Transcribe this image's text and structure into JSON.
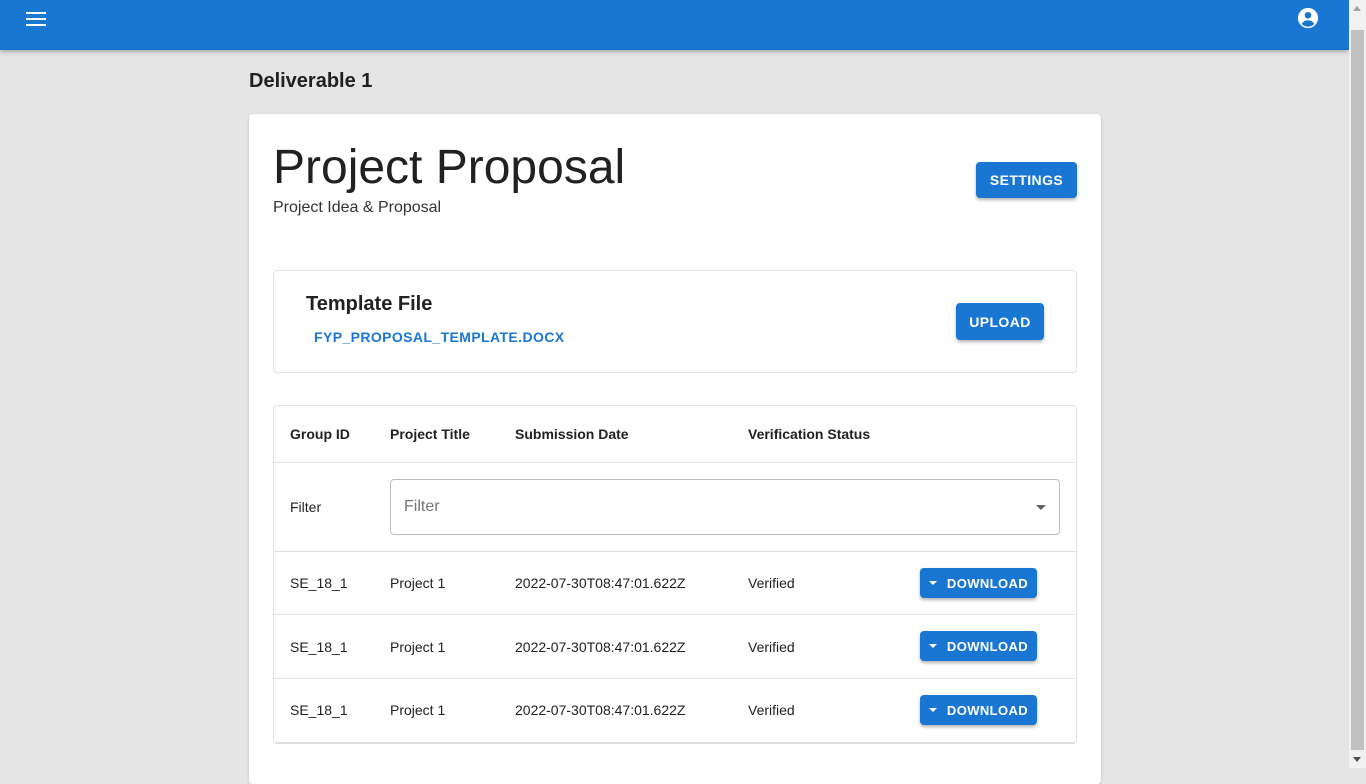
{
  "appbar": {
    "menu_icon": "menu-icon",
    "account_icon": "account-circle-icon",
    "color": "#1976d2"
  },
  "page": {
    "heading": "Deliverable 1"
  },
  "card": {
    "title": "Project Proposal",
    "subtitle": "Project Idea & Proposal",
    "settings_label": "SETTINGS"
  },
  "template": {
    "title": "Template File",
    "file_name": "FYP_PROPOSAL_TEMPLATE.DOCX",
    "upload_label": "UPLOAD"
  },
  "table": {
    "headers": [
      "Group ID",
      "Project Title",
      "Submission Date",
      "Verification Status"
    ],
    "filter_label": "Filter",
    "filter_placeholder": "Filter",
    "download_label": "DOWNLOAD",
    "rows": [
      {
        "group_id": "SE_18_1",
        "project_title": "Project 1",
        "submission_date": "2022-07-30T08:47:01.622Z",
        "status": "Verified"
      },
      {
        "group_id": "SE_18_1",
        "project_title": "Project 1",
        "submission_date": "2022-07-30T08:47:01.622Z",
        "status": "Verified"
      },
      {
        "group_id": "SE_18_1",
        "project_title": "Project 1",
        "submission_date": "2022-07-30T08:47:01.622Z",
        "status": "Verified"
      }
    ]
  }
}
